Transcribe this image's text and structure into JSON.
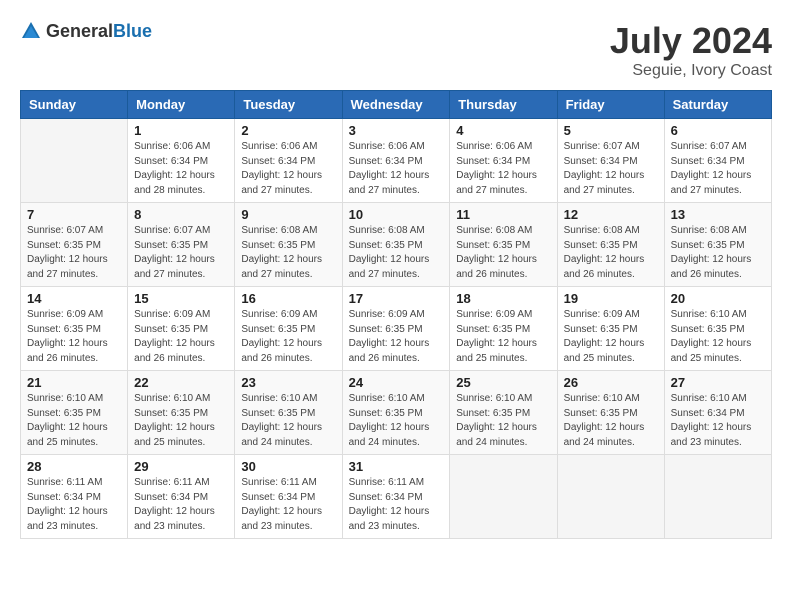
{
  "header": {
    "logo_general": "General",
    "logo_blue": "Blue",
    "month_year": "July 2024",
    "location": "Seguie, Ivory Coast"
  },
  "weekdays": [
    "Sunday",
    "Monday",
    "Tuesday",
    "Wednesday",
    "Thursday",
    "Friday",
    "Saturday"
  ],
  "weeks": [
    [
      {
        "day": "",
        "info": ""
      },
      {
        "day": "1",
        "info": "Sunrise: 6:06 AM\nSunset: 6:34 PM\nDaylight: 12 hours\nand 28 minutes."
      },
      {
        "day": "2",
        "info": "Sunrise: 6:06 AM\nSunset: 6:34 PM\nDaylight: 12 hours\nand 27 minutes."
      },
      {
        "day": "3",
        "info": "Sunrise: 6:06 AM\nSunset: 6:34 PM\nDaylight: 12 hours\nand 27 minutes."
      },
      {
        "day": "4",
        "info": "Sunrise: 6:06 AM\nSunset: 6:34 PM\nDaylight: 12 hours\nand 27 minutes."
      },
      {
        "day": "5",
        "info": "Sunrise: 6:07 AM\nSunset: 6:34 PM\nDaylight: 12 hours\nand 27 minutes."
      },
      {
        "day": "6",
        "info": "Sunrise: 6:07 AM\nSunset: 6:34 PM\nDaylight: 12 hours\nand 27 minutes."
      }
    ],
    [
      {
        "day": "7",
        "info": "Sunrise: 6:07 AM\nSunset: 6:35 PM\nDaylight: 12 hours\nand 27 minutes."
      },
      {
        "day": "8",
        "info": "Sunrise: 6:07 AM\nSunset: 6:35 PM\nDaylight: 12 hours\nand 27 minutes."
      },
      {
        "day": "9",
        "info": "Sunrise: 6:08 AM\nSunset: 6:35 PM\nDaylight: 12 hours\nand 27 minutes."
      },
      {
        "day": "10",
        "info": "Sunrise: 6:08 AM\nSunset: 6:35 PM\nDaylight: 12 hours\nand 27 minutes."
      },
      {
        "day": "11",
        "info": "Sunrise: 6:08 AM\nSunset: 6:35 PM\nDaylight: 12 hours\nand 26 minutes."
      },
      {
        "day": "12",
        "info": "Sunrise: 6:08 AM\nSunset: 6:35 PM\nDaylight: 12 hours\nand 26 minutes."
      },
      {
        "day": "13",
        "info": "Sunrise: 6:08 AM\nSunset: 6:35 PM\nDaylight: 12 hours\nand 26 minutes."
      }
    ],
    [
      {
        "day": "14",
        "info": "Sunrise: 6:09 AM\nSunset: 6:35 PM\nDaylight: 12 hours\nand 26 minutes."
      },
      {
        "day": "15",
        "info": "Sunrise: 6:09 AM\nSunset: 6:35 PM\nDaylight: 12 hours\nand 26 minutes."
      },
      {
        "day": "16",
        "info": "Sunrise: 6:09 AM\nSunset: 6:35 PM\nDaylight: 12 hours\nand 26 minutes."
      },
      {
        "day": "17",
        "info": "Sunrise: 6:09 AM\nSunset: 6:35 PM\nDaylight: 12 hours\nand 26 minutes."
      },
      {
        "day": "18",
        "info": "Sunrise: 6:09 AM\nSunset: 6:35 PM\nDaylight: 12 hours\nand 25 minutes."
      },
      {
        "day": "19",
        "info": "Sunrise: 6:09 AM\nSunset: 6:35 PM\nDaylight: 12 hours\nand 25 minutes."
      },
      {
        "day": "20",
        "info": "Sunrise: 6:10 AM\nSunset: 6:35 PM\nDaylight: 12 hours\nand 25 minutes."
      }
    ],
    [
      {
        "day": "21",
        "info": "Sunrise: 6:10 AM\nSunset: 6:35 PM\nDaylight: 12 hours\nand 25 minutes."
      },
      {
        "day": "22",
        "info": "Sunrise: 6:10 AM\nSunset: 6:35 PM\nDaylight: 12 hours\nand 25 minutes."
      },
      {
        "day": "23",
        "info": "Sunrise: 6:10 AM\nSunset: 6:35 PM\nDaylight: 12 hours\nand 24 minutes."
      },
      {
        "day": "24",
        "info": "Sunrise: 6:10 AM\nSunset: 6:35 PM\nDaylight: 12 hours\nand 24 minutes."
      },
      {
        "day": "25",
        "info": "Sunrise: 6:10 AM\nSunset: 6:35 PM\nDaylight: 12 hours\nand 24 minutes."
      },
      {
        "day": "26",
        "info": "Sunrise: 6:10 AM\nSunset: 6:35 PM\nDaylight: 12 hours\nand 24 minutes."
      },
      {
        "day": "27",
        "info": "Sunrise: 6:10 AM\nSunset: 6:34 PM\nDaylight: 12 hours\nand 23 minutes."
      }
    ],
    [
      {
        "day": "28",
        "info": "Sunrise: 6:11 AM\nSunset: 6:34 PM\nDaylight: 12 hours\nand 23 minutes."
      },
      {
        "day": "29",
        "info": "Sunrise: 6:11 AM\nSunset: 6:34 PM\nDaylight: 12 hours\nand 23 minutes."
      },
      {
        "day": "30",
        "info": "Sunrise: 6:11 AM\nSunset: 6:34 PM\nDaylight: 12 hours\nand 23 minutes."
      },
      {
        "day": "31",
        "info": "Sunrise: 6:11 AM\nSunset: 6:34 PM\nDaylight: 12 hours\nand 23 minutes."
      },
      {
        "day": "",
        "info": ""
      },
      {
        "day": "",
        "info": ""
      },
      {
        "day": "",
        "info": ""
      }
    ]
  ]
}
